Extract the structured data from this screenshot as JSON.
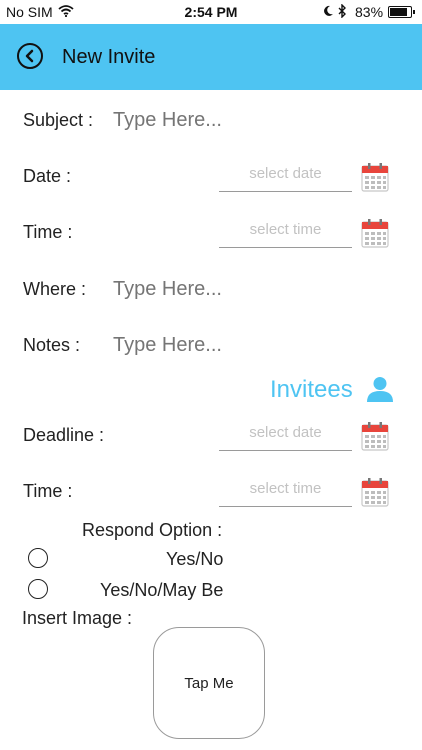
{
  "status_bar": {
    "carrier": "No SIM",
    "time": "2:54 PM",
    "battery_percent": "83%",
    "battery_level": 0.83
  },
  "nav": {
    "title": "New Invite",
    "back_icon": "back-circle-icon",
    "color": "#4ec4f2"
  },
  "form": {
    "subject": {
      "label": "Subject :",
      "placeholder": "Type Here..."
    },
    "date": {
      "label": "Date :",
      "placeholder": "select date"
    },
    "time": {
      "label": "Time :",
      "placeholder": "select time"
    },
    "where": {
      "label": "Where :",
      "placeholder": "Type Here..."
    },
    "notes": {
      "label": "Notes :",
      "placeholder": "Type Here..."
    }
  },
  "invitees": {
    "label": "Invitees",
    "icon": "person-icon"
  },
  "deadline": {
    "label": "Deadline :",
    "placeholder": "select date",
    "time_label": "Time :",
    "time_placeholder": "select time"
  },
  "respond": {
    "title": "Respond Option :",
    "options": [
      "Yes/No",
      "Yes/No/May Be"
    ]
  },
  "insert_image": {
    "label": "Insert Image :",
    "button_label": "Tap Me"
  },
  "icons": {
    "calendar": "calendar-icon",
    "accent_red": "#e8453c"
  }
}
